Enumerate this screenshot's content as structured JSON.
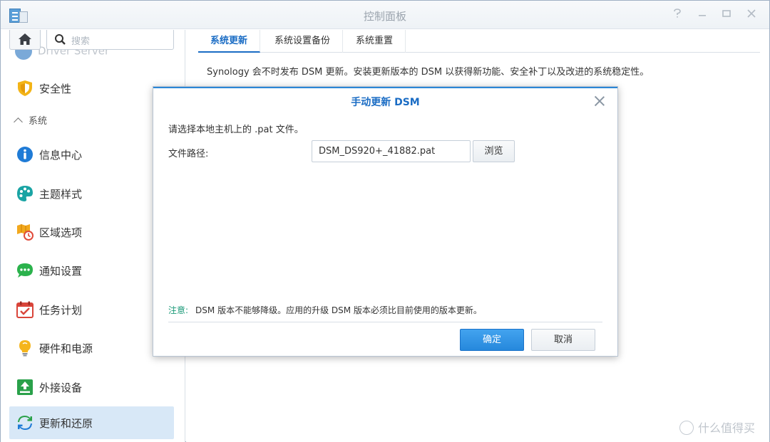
{
  "window": {
    "title": "控制面板"
  },
  "sidebar": {
    "search_placeholder": "搜索",
    "cut_item_label": "Driver Server",
    "section_label": "系统",
    "items": [
      {
        "label": "安全性",
        "icon": "shield-icon"
      },
      {
        "label": "信息中心",
        "icon": "info-icon"
      },
      {
        "label": "主题样式",
        "icon": "palette-icon"
      },
      {
        "label": "区域选项",
        "icon": "map-clock-icon"
      },
      {
        "label": "通知设置",
        "icon": "chat-bubble-icon"
      },
      {
        "label": "任务计划",
        "icon": "calendar-check-icon"
      },
      {
        "label": "硬件和电源",
        "icon": "lightbulb-icon"
      },
      {
        "label": "外接设备",
        "icon": "upload-device-icon"
      },
      {
        "label": "更新和还原",
        "icon": "refresh-icon"
      }
    ]
  },
  "main": {
    "tabs": [
      {
        "label": "系统更新"
      },
      {
        "label": "系统设置备份"
      },
      {
        "label": "系统重置"
      }
    ],
    "description": "Synology 会不时发布 DSM 更新。安装更新版本的 DSM 以获得新功能、安全补丁以及改进的系统稳定性。"
  },
  "dialog": {
    "title": "手动更新 DSM",
    "hint": "请选择本地主机上的 .pat 文件。",
    "field_label": "文件路径:",
    "file_value": "DSM_DS920+_41882.pat",
    "browse_label": "浏览",
    "note_tag": "注意:",
    "note_text": "DSM 版本不能够降级。应用的升级 DSM 版本必须比目前使用的版本更新。",
    "ok_label": "确定",
    "cancel_label": "取消"
  },
  "watermark": {
    "text": "什么值得买"
  },
  "colors": {
    "accent": "#1a6cc4",
    "primary_button": "#2b8ae0",
    "note": "#1b9a78",
    "active_nav": "#d8e8f7"
  }
}
